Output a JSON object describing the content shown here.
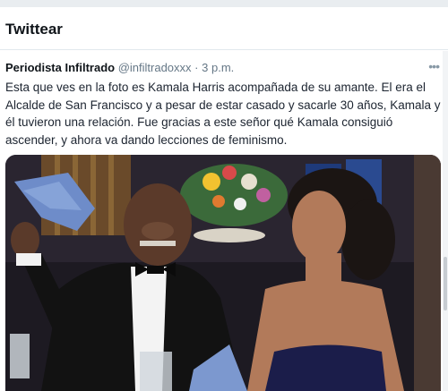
{
  "header": {
    "title": "Twittear"
  },
  "tweet": {
    "author_name": "Periodista Infiltrado",
    "author_handle": "@infiltradoxxx",
    "separator": "·",
    "time": "3 p.m.",
    "more_icon": "more-dots-icon",
    "text": "Esta que ves en la foto es Kamala Harris acompañada de su amante. El era el Alcalde de San Francisco y a pesar de estar casado y sacarle 30 años, Kamala y él tuvieron una relación. Fue gracias a este señor qué Kamala consiguió ascender, y ahora va dando lecciones de feminismo."
  },
  "colors": {
    "text": "#1c2430",
    "muted": "#657786",
    "tuxedo": "#121212",
    "dress": "#1b1d4a",
    "napkin": "#6e8cc9"
  }
}
